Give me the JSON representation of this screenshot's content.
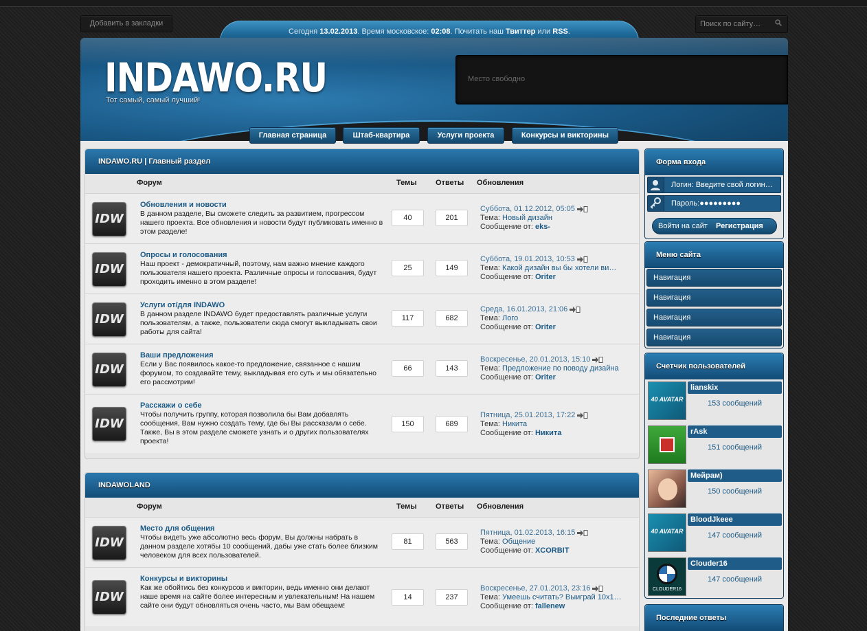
{
  "topbar": {
    "bookmark_label": "Добавить в закладки",
    "search_placeholder": "Поиск по сайту…",
    "date_prefix": "Сегодня",
    "date": "13.02.2013",
    "time_prefix": ". Время московское:",
    "time": "02:08",
    "read_text": ". Почитать наш",
    "twitter": "Твиттер",
    "or": "или",
    "rss": "RSS",
    "end": "."
  },
  "header": {
    "logo": "INDAWO.RU",
    "slogan": "Тот самый, самый лучший!",
    "ad_text": "Место свободно"
  },
  "nav": [
    "Главная страница",
    "Штаб-квартира",
    "Услуги проекта",
    "Конкурсы и викторины"
  ],
  "columns": {
    "forum": "Форум",
    "topics": "Темы",
    "replies": "Ответы",
    "updates": "Обновления"
  },
  "sections": [
    {
      "title": "INDAWO.RU | Главный раздел",
      "forums": [
        {
          "icon": "IDW",
          "title": "Обновления и новости",
          "desc": "В данном разделе, Вы сможете следить за развитием, прогрессом нашего проекта. Все обновления и новости будут публиковать именно в этом разделе!",
          "topics": "40",
          "replies": "201",
          "date": "Суббота, 01.12.2012, 05:05",
          "theme_label": "Тема:",
          "theme": "Новый дизайн",
          "msg_label": "Сообщение от:",
          "author": "eks-"
        },
        {
          "icon": "IDW",
          "title": "Опросы и голосования",
          "desc": "Наш проект - демократичный, поэтому, нам важно мнение каждого пользователя нашего проекта. Различные опросы и голосвания, будут проходить именно в этом разделе!",
          "topics": "25",
          "replies": "149",
          "date": "Суббота, 19.01.2013, 10:53",
          "theme_label": "Тема:",
          "theme": "Какой дизайн вы бы хотели ви…",
          "msg_label": "Сообщение от:",
          "author": "Oriter"
        },
        {
          "icon": "IDW",
          "title": "Услуги от/для INDAWO",
          "desc": "В данном разделе INDAWO будет предоставлять различные услуги пользователям, а также, пользователи сюда смогут выкладывать свои работы для сайта!",
          "topics": "117",
          "replies": "682",
          "date": "Среда, 16.01.2013, 21:06",
          "theme_label": "Тема:",
          "theme": "Лого",
          "msg_label": "Сообщение от:",
          "author": "Oriter"
        },
        {
          "icon": "IDW",
          "title": "Ваши предложения",
          "desc": "Если у Вас появилось какое-то предложение, связанное с нашим форумом, то создавайте тему, выкладывая его суть и мы обязательно его рассмотрим!",
          "topics": "66",
          "replies": "143",
          "date": "Воскресенье, 20.01.2013, 15:10",
          "theme_label": "Тема:",
          "theme": "Предложение по поводу дизайна",
          "msg_label": "Сообщение от:",
          "author": "Oriter"
        },
        {
          "icon": "IDW",
          "title": "Расскажи о себе",
          "desc": "Чтобы получить группу, которая позволила бы Вам добавлять сообщения, Вам нужно создать тему, где бы Вы рассказали о себе. Также, Вы в этом разделе сможете узнать и о других пользователях проекта!",
          "topics": "150",
          "replies": "689",
          "date": "Пятница, 25.01.2013, 17:22",
          "theme_label": "Тема:",
          "theme": "Никита",
          "msg_label": "Сообщение от:",
          "author": "Никита"
        }
      ]
    },
    {
      "title": "INDAWOLAND",
      "forums": [
        {
          "icon": "IDW",
          "title": "Место для общения",
          "desc": "Чтобы видеть уже абсолютно весь форум, Вы должны набрать в данном разделе хотябы 10 сообщений, дабы уже стать более близким человеком для всех пользователей.",
          "topics": "81",
          "replies": "563",
          "date": "Пятница, 01.02.2013, 16:15",
          "theme_label": "Тема:",
          "theme": "Общение",
          "msg_label": "Сообщение от:",
          "author": "XCORBIT"
        },
        {
          "icon": "IDW",
          "title": "Конкурсы и викторины",
          "desc": "Как же обойтись без конкурсов и викторин, ведь именно они делают наше время на сайте более интересным и увлекательным! На нашем сайте они будут обновляться очень часто, мы Вам обещаем!",
          "topics": "14",
          "replies": "237",
          "date": "Воскресенье, 27.01.2013, 23:16",
          "theme_label": "Тема:",
          "theme": "Умеешь считать? Выиграй 10х1…",
          "msg_label": "Сообщение от:",
          "author": "fallenew"
        }
      ]
    }
  ],
  "sidebar": {
    "login": {
      "title": "Форма входа",
      "login_label": "Логин:",
      "login_placeholder": "Введите свой логин…",
      "password_label": "Пароль:",
      "password_value": "●●●●●●●●●",
      "login_button": "Войти на сайт",
      "register_button": "Регистрация"
    },
    "menu": {
      "title": "Меню сайта",
      "items": [
        "Навигация",
        "Навигация",
        "Навигация",
        "Навигация"
      ]
    },
    "users": {
      "title": "Счетчик пользователей",
      "list": [
        {
          "name": "lianskix",
          "posts": "153 сообщений",
          "avatar_text": "40 AVATAR"
        },
        {
          "name": "rAsk",
          "posts": "151 сообщений",
          "avatar_text": ""
        },
        {
          "name": "Мейрам)",
          "posts": "150 сообщений",
          "avatar_text": ""
        },
        {
          "name": "BloodJkeee",
          "posts": "147 сообщений",
          "avatar_text": "40 AVATAR"
        },
        {
          "name": "Clouder16",
          "posts": "147 сообщений",
          "avatar_text": "CLOUDER16"
        }
      ]
    },
    "recent": {
      "title": "Последние ответы"
    }
  },
  "colors": {
    "accent": "#1b5a86",
    "header_blue": "#1f6b9a",
    "page_bg": "#222222"
  }
}
